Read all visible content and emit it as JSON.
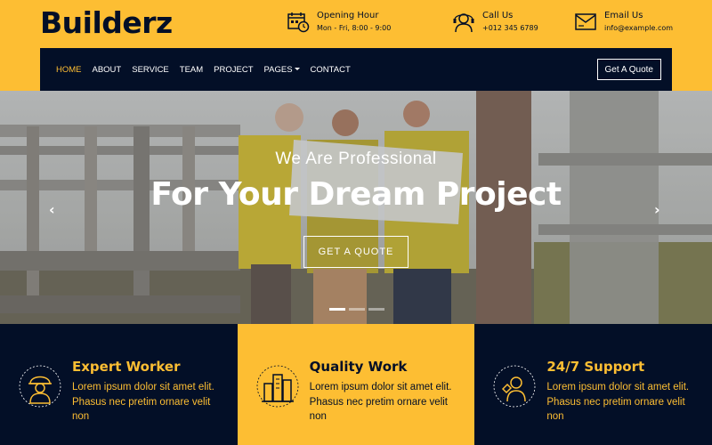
{
  "brand": {
    "logo": "Builderz"
  },
  "header": {
    "hours": {
      "title": "Opening Hour",
      "value": "Mon - Fri, 8:00 - 9:00",
      "icon": "calendar-clock-icon"
    },
    "call": {
      "title": "Call Us",
      "value": "+012 345 6789",
      "icon": "phone-support-icon"
    },
    "email": {
      "title": "Email Us",
      "value": "info@example.com",
      "icon": "email-icon"
    }
  },
  "nav": {
    "items": [
      "HOME",
      "ABOUT",
      "SERVICE",
      "TEAM",
      "PROJECT",
      "PAGES",
      "CONTACT"
    ],
    "active": "HOME",
    "quote_label": "Get A Quote"
  },
  "hero": {
    "subtitle": "We Are Professional",
    "title": "For Your Dream Project",
    "button": "GET A QUOTE",
    "prev": "‹",
    "next": "›",
    "slides": 3,
    "active_slide": 1
  },
  "features": [
    {
      "title": "Expert Worker",
      "text": "Lorem ipsum dolor sit amet elit. Phasus nec pretim ornare velit non",
      "icon": "worker-icon"
    },
    {
      "title": "Quality Work",
      "text": "Lorem ipsum dolor sit amet elit. Phasus nec pretim ornare velit non",
      "icon": "building-icon"
    },
    {
      "title": "24/7 Support",
      "text": "Lorem ipsum dolor sit amet elit. Phasus nec pretim ornare velit non",
      "icon": "support-icon"
    }
  ],
  "colors": {
    "accent": "#fdbe33",
    "dark": "#030f27",
    "white": "#ffffff"
  }
}
